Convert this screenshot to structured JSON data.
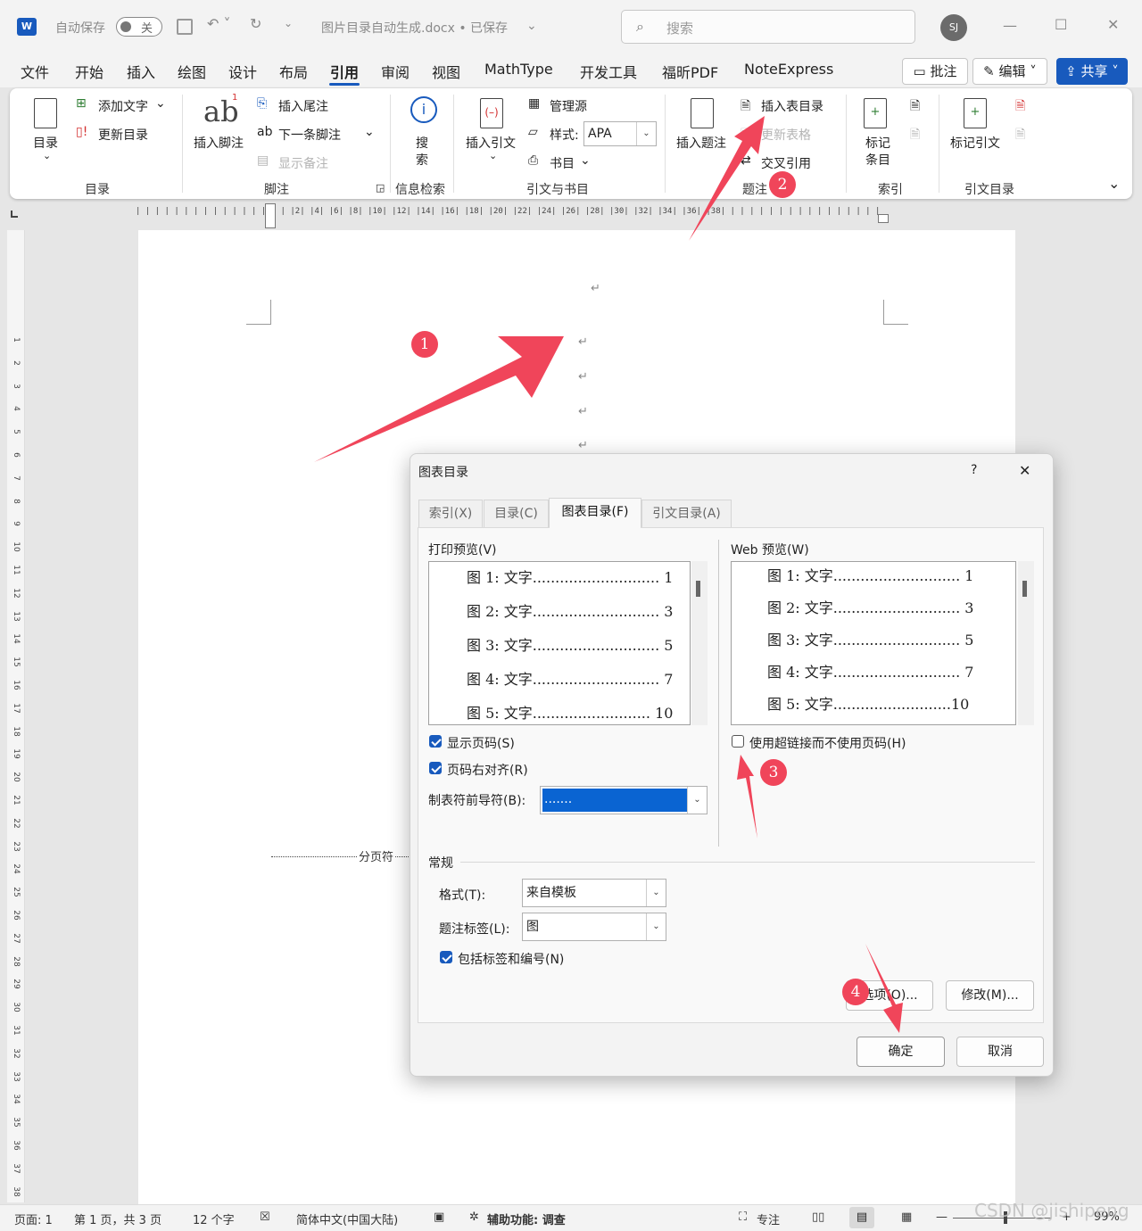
{
  "titlebar": {
    "autosave_label": "自动保存",
    "autosave_state": "关",
    "document_title": "图片目录自动生成.docx • 已保存",
    "search_placeholder": "搜索",
    "avatar_initials": "SJ"
  },
  "tabs": [
    "文件",
    "开始",
    "插入",
    "绘图",
    "设计",
    "布局",
    "引用",
    "审阅",
    "视图",
    "MathType",
    "开发工具",
    "福昕PDF",
    "NoteExpress"
  ],
  "active_tab": "引用",
  "header_buttons": {
    "comments": "批注",
    "editing": "编辑",
    "share": "共享"
  },
  "ribbon": {
    "toc": {
      "big": "目录",
      "add_text": "添加文字",
      "update": "更新目录",
      "group": "目录"
    },
    "footnotes": {
      "insert_footnote": "插入脚注",
      "insert_endnote": "插入尾注",
      "next_footnote": "下一条脚注",
      "show_notes": "显示备注",
      "group": "脚注"
    },
    "research": {
      "search_a": "搜",
      "search_b": "索",
      "group": "信息检索"
    },
    "citations": {
      "insert_citation": "插入引文",
      "manage_sources": "管理源",
      "style_label": "样式:",
      "style_value": "APA",
      "bibliography": "书目",
      "group": "引文与书目"
    },
    "captions": {
      "insert_caption": "插入题注",
      "insert_table_figures": "插入表目录",
      "update_table": "更新表格",
      "cross_reference": "交叉引用",
      "group": "题注"
    },
    "index": {
      "mark_entry_a": "标记",
      "mark_entry_b": "条目",
      "group": "索引"
    },
    "authorities": {
      "mark_citation": "标记引文",
      "group": "引文目录"
    }
  },
  "ruler_text": "| | | | | | | | | | | | | | | | |2| |4| |6| |8| |10| |12| |14| |16| |18| |20| |22| |24| |26| |28| |30| |32| |34| |36| |38| | | | | | | | | | | | | | | | | |",
  "vruler_marks": [
    "1",
    "2",
    "3",
    "4",
    "5",
    "6",
    "7",
    "8",
    "9",
    "10",
    "11",
    "12",
    "13",
    "14",
    "15",
    "16",
    "17",
    "18",
    "19",
    "20",
    "21",
    "22",
    "23",
    "24",
    "25",
    "26",
    "27",
    "28",
    "29",
    "30",
    "31",
    "32",
    "33",
    "34",
    "35",
    "36",
    "37",
    "38"
  ],
  "document": {
    "pilcrow": "↵",
    "page_break": "分页符"
  },
  "dialog": {
    "title": "图表目录",
    "help": "?",
    "close": "✕",
    "tabs": [
      "索引(X)",
      "目录(C)",
      "图表目录(F)",
      "引文目录(A)"
    ],
    "print_preview_label": "打印预览(V)",
    "print_preview_lines": [
      "图 1: 文字............................ 1",
      "图 2: 文字............................ 3",
      "图 3: 文字............................ 5",
      "图 4: 文字............................ 7",
      "图 5: 文字.......................... 10"
    ],
    "web_preview_label": "Web 预览(W)",
    "web_preview_lines": [
      "图 1: 文字............................ 1",
      "图 2: 文字............................ 3",
      "图 3: 文字............................ 5",
      "图 4: 文字............................ 7",
      "图 5: 文字..........................10"
    ],
    "show_page_numbers": "显示页码(S)",
    "show_page_numbers_checked": true,
    "right_align": "页码右对齐(R)",
    "right_align_checked": true,
    "tab_leader_label": "制表符前导符(B):",
    "tab_leader_value": ".......",
    "use_hyperlinks": "使用超链接而不使用页码(H)",
    "use_hyperlinks_checked": false,
    "general_label": "常规",
    "formats_label": "格式(T):",
    "formats_value": "来自模板",
    "caption_label": "题注标签(L):",
    "caption_value": "图",
    "include_label": "包括标签和编号(N)",
    "include_label_checked": true,
    "options_button": "选项(O)...",
    "modify_button": "修改(M)...",
    "ok_button": "确定",
    "cancel_button": "取消"
  },
  "annotations": {
    "badges": [
      "1",
      "2",
      "3",
      "4"
    ],
    "color": "#f0455a"
  },
  "statusbar": {
    "page": "页面: 1",
    "pages": "第 1 页，共 3 页",
    "words": "12 个字",
    "language": "简体中文(中国大陆)",
    "accessibility": "辅助功能: 调查",
    "focus": "专注",
    "zoom": "99%"
  },
  "watermark": "CSDN @jishipeng"
}
